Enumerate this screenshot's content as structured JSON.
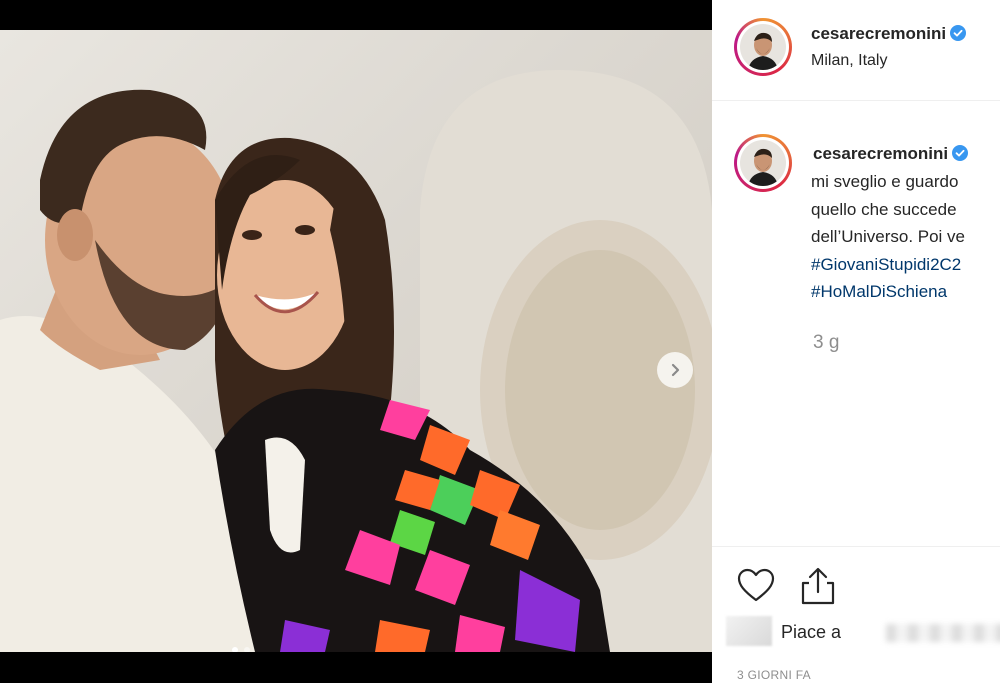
{
  "post": {
    "author": {
      "username": "cesarecremonini",
      "verified": true,
      "location": "Milan, Italy"
    },
    "caption": {
      "username": "cesarecremonini",
      "lines": [
        "mi sveglio e guardo",
        "quello che succede",
        "dell’Universo. Poi ve"
      ],
      "hashtags": [
        "#GiovaniStupidi2C2",
        "#HoMalDiSchiena"
      ]
    },
    "age": "3 g",
    "likes_text": "Piace a",
    "timestamp": "3 GIORNI FA",
    "carousel": {
      "count": 2,
      "active_index": 0
    }
  },
  "colors": {
    "link": "#00376b",
    "verified": "#3897f0",
    "secondary_text": "#8e8e8e",
    "primary_text": "#262626"
  }
}
